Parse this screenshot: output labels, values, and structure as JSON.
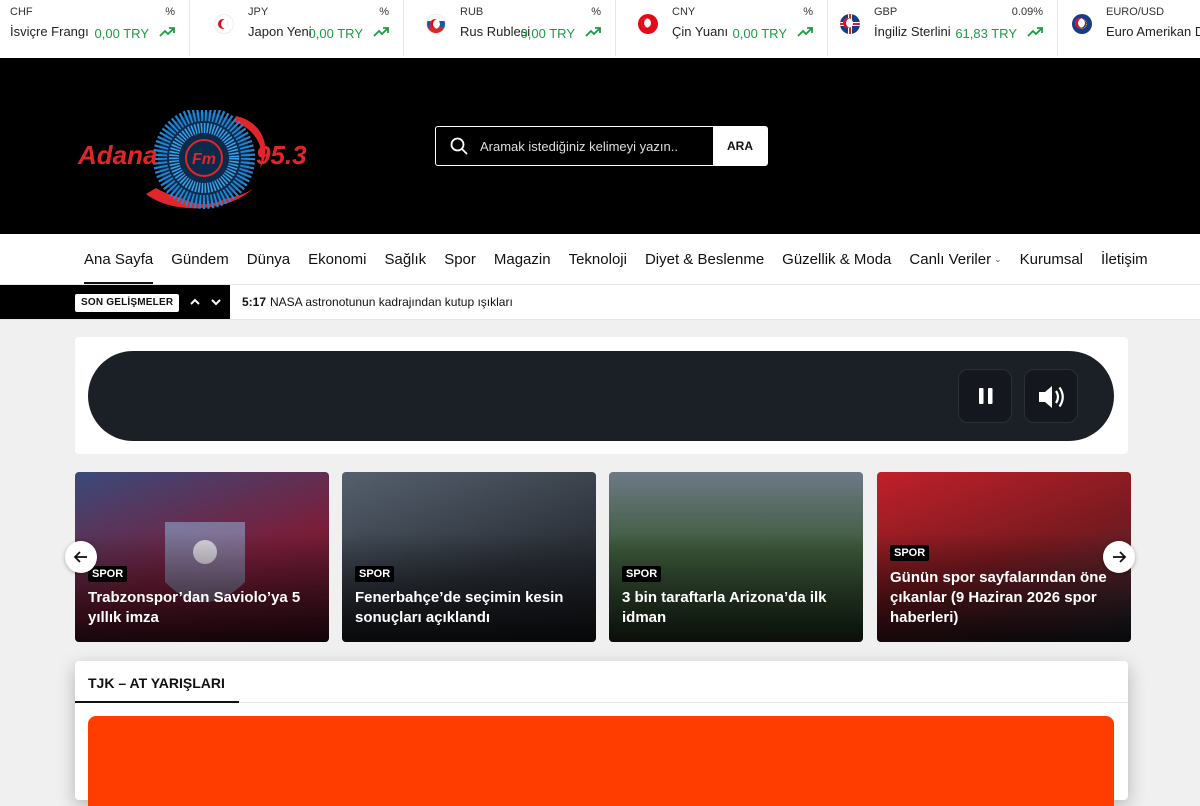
{
  "ticker": [
    {
      "code": "CHF",
      "pct": "%",
      "name": "İsviçre Frangı",
      "value": "0,00 TRY",
      "flag_color": "#e30a17"
    },
    {
      "code": "JPY",
      "pct": "%",
      "name": "Japon Yeni",
      "value": "0,00 TRY",
      "flag_color": "#e30a17"
    },
    {
      "code": "RUB",
      "pct": "%",
      "name": "Rus Rublesi",
      "value": "0,00 TRY",
      "flag_color": "#e30a17"
    },
    {
      "code": "CNY",
      "pct": "%",
      "name": "Çin Yuanı",
      "value": "0,00 TRY",
      "flag_color": "#e30a17"
    },
    {
      "code": "GBP",
      "pct": "0.09%",
      "name": "İngiliz Sterlini",
      "value": "61,83 TRY",
      "flag_color": "#e30a17"
    },
    {
      "code": "EURO/USD",
      "pct": "",
      "name": "Euro Amerikan D",
      "value": "",
      "flag_color": "#e30a17"
    }
  ],
  "header": {
    "logo_text_left": "Adana",
    "logo_text_center": "Fm",
    "logo_text_right": "95.3",
    "search_placeholder": "Aramak istediğiniz kelimeyi yazın..",
    "search_button": "ARA"
  },
  "nav": {
    "items": [
      {
        "label": "Ana Sayfa"
      },
      {
        "label": "Gündem"
      },
      {
        "label": "Dünya"
      },
      {
        "label": "Ekonomi"
      },
      {
        "label": "Sağlık"
      },
      {
        "label": "Spor"
      },
      {
        "label": "Magazin"
      },
      {
        "label": "Teknoloji"
      },
      {
        "label": "Diyet & Beslenme"
      },
      {
        "label": "Güzellik & Moda"
      },
      {
        "label": "Canlı Veriler"
      },
      {
        "label": "Kurumsal"
      },
      {
        "label": "İletişim"
      }
    ],
    "dropdown_caret": "⌄"
  },
  "breaking": {
    "label": "SON GELİŞMELER",
    "time": "5:17",
    "text": "NASA astronotunun kadrajından kutup ışıkları"
  },
  "cards": [
    {
      "category": "SPOR",
      "title": "Trabzonspor’dan Saviolo’ya 5 yıllık imza",
      "bg": "#7a1e3a"
    },
    {
      "category": "SPOR",
      "title": "Fenerbahçe’de seçimin kesin sonuçları açıklandı",
      "bg": "#3a3f47"
    },
    {
      "category": "SPOR",
      "title": "3 bin taraftarla Arizona’da ilk idman",
      "bg": "#3b5a3a"
    },
    {
      "category": "SPOR",
      "title": "Günün spor sayfalarından öne çıkanlar (9 Haziran 2026 spor haberleri)",
      "bg": "#8a1a1a"
    }
  ],
  "tjk": {
    "title": "TJK – AT YARIŞLARI"
  },
  "colors": {
    "accent": "#ff3d00",
    "trend_green": "#1a9c43",
    "logo_red": "#e0262b",
    "logo_blue": "#1e88d6"
  }
}
